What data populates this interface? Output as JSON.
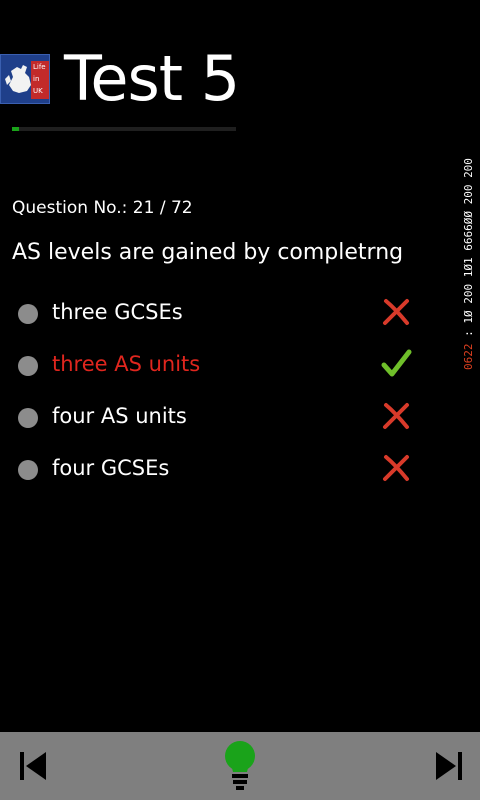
{
  "app": {
    "logo_text": [
      "Life",
      "in",
      "UK"
    ],
    "title": "Test 5"
  },
  "progress": {
    "current": 21,
    "total": 72,
    "fill_fraction": 0.03,
    "color": "#1aa31a"
  },
  "debug_overlay": {
    "prefix": "0622",
    "rest": " : 1Ø 200 1Ø1 6666ØØ 200 200"
  },
  "question": {
    "number_label": "Question No.: 21 / 72",
    "text": "AS levels are gained by completrng"
  },
  "options": [
    {
      "label": "three GCSEs",
      "correct": false,
      "mark_icon": "cross-icon"
    },
    {
      "label": "three AS units",
      "correct": true,
      "mark_icon": "check-icon"
    },
    {
      "label": "four AS units",
      "correct": false,
      "mark_icon": "cross-icon"
    },
    {
      "label": "four GCSEs",
      "correct": false,
      "mark_icon": "cross-icon"
    }
  ],
  "colors": {
    "correct_text": "#e0261e",
    "check": "#6fbf2a",
    "cross": "#d83a2a",
    "appbar": "#7f7f7f",
    "hint_bulb": "#1aa31a"
  },
  "appbar": {
    "buttons": [
      "skip-previous-icon",
      "lightbulb-icon",
      "skip-next-icon"
    ]
  }
}
